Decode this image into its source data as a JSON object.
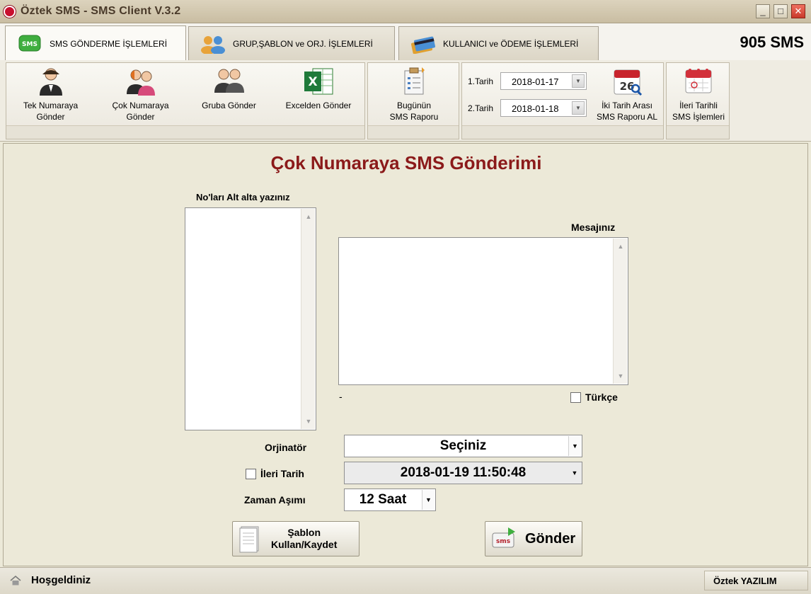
{
  "window": {
    "title": "Öztek SMS - SMS Client  V.3.2",
    "minimize": "_",
    "maximize": "□",
    "close": "✕"
  },
  "tabs": [
    {
      "label": "SMS GÖNDERME İŞLEMLERİ",
      "active": true
    },
    {
      "label": "GRUP,ŞABLON ve ORJ. İŞLEMLERİ",
      "active": false
    },
    {
      "label": "KULLANICI ve ÖDEME İŞLEMLERİ",
      "active": false
    }
  ],
  "sms_balance": "905 SMS",
  "ribbon": {
    "single": {
      "line1": "Tek Numaraya",
      "line2": "Gönder",
      "icon": "user-icon"
    },
    "multi": {
      "line1": "Çok Numaraya",
      "line2": "Gönder",
      "icon": "users-icon"
    },
    "group": {
      "line1": "Gruba Gönder",
      "icon": "group-icon"
    },
    "excel": {
      "line1": "Excelden Gönder",
      "icon": "excel-icon"
    },
    "today_report": {
      "line1": "Bugünün",
      "line2": "SMS Raporu",
      "icon": "report-icon"
    },
    "date1_label": "1.Tarih",
    "date1_value": "2018-01-17",
    "date2_label": "2.Tarih",
    "date2_value": "2018-01-18",
    "range_report": {
      "line1": "İki Tarih Arası",
      "line2": "SMS Raporu AL",
      "icon": "calendar-search-icon",
      "cal_day": "26"
    },
    "scheduled": {
      "line1": "İleri Tarihli",
      "line2": "SMS İşlemleri",
      "icon": "calendar-icon"
    }
  },
  "form": {
    "heading": "Çok Numaraya SMS Gönderimi",
    "numbers_label": "No'ları Alt alta yazınız",
    "numbers_value": "",
    "message_label": "Mesajınız",
    "message_value": "",
    "char_counter": "-",
    "turkish_label": "Türkçe",
    "turkish_checked": false,
    "originator_label": "Orjinatör",
    "originator_value": "Seçiniz",
    "future_date_label": "İleri Tarih",
    "future_date_checked": false,
    "future_date_value": "2018-01-19 11:50:48",
    "timeout_label": "Zaman Aşımı",
    "timeout_value": "12 Saat",
    "template_button": {
      "line1": "Şablon",
      "line2": "Kullan/Kaydet"
    },
    "send_button": "Gönder",
    "send_icon_text": "sms"
  },
  "status": {
    "left": "Hoşgeldiniz",
    "right": "Öztek YAZILIM"
  },
  "colors": {
    "heading": "#8b1a1a",
    "close_button": "#c8382a",
    "sms_icon_green": "#3fae3f"
  }
}
